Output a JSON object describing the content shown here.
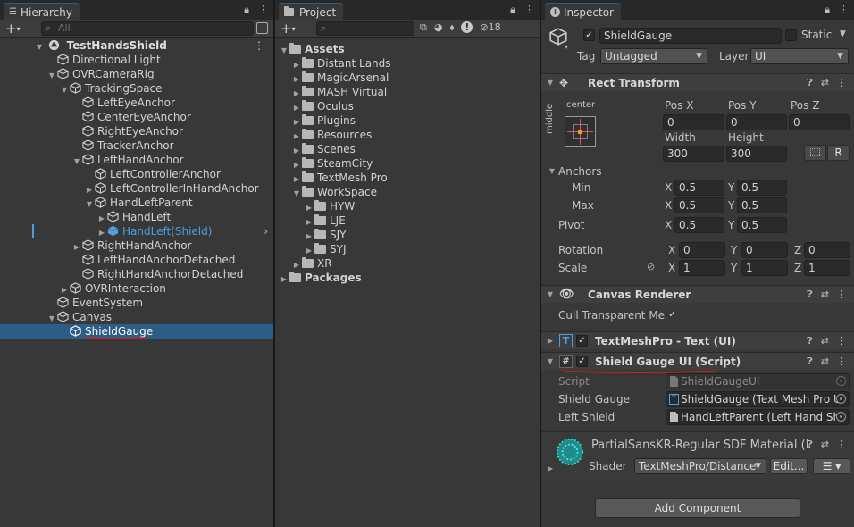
{
  "hierarchy": {
    "tab_label": "Hierarchy",
    "search_placeholder": "All",
    "scene_name": "TestHandsShield",
    "items": [
      {
        "label": "Directional Light"
      },
      {
        "label": "OVRCameraRig"
      },
      {
        "label": "TrackingSpace"
      },
      {
        "label": "LeftEyeAnchor"
      },
      {
        "label": "CenterEyeAnchor"
      },
      {
        "label": "RightEyeAnchor"
      },
      {
        "label": "TrackerAnchor"
      },
      {
        "label": "LeftHandAnchor"
      },
      {
        "label": "LeftControllerAnchor"
      },
      {
        "label": "LeftControllerInHandAnchor"
      },
      {
        "label": "HandLeftParent"
      },
      {
        "label": "HandLeft"
      },
      {
        "label": "HandLeft(Shield)"
      },
      {
        "label": "RightHandAnchor"
      },
      {
        "label": "LeftHandAnchorDetached"
      },
      {
        "label": "RightHandAnchorDetached"
      },
      {
        "label": "OVRInteraction"
      },
      {
        "label": "EventSystem"
      },
      {
        "label": "Canvas"
      },
      {
        "label": "ShieldGauge"
      }
    ]
  },
  "project": {
    "tab_label": "Project",
    "hidden_count": "18",
    "items": [
      {
        "label": "Assets"
      },
      {
        "label": "Distant Lands"
      },
      {
        "label": "MagicArsenal"
      },
      {
        "label": "MASH Virtual"
      },
      {
        "label": "Oculus"
      },
      {
        "label": "Plugins"
      },
      {
        "label": "Resources"
      },
      {
        "label": "Scenes"
      },
      {
        "label": "SteamCity"
      },
      {
        "label": "TextMesh Pro"
      },
      {
        "label": "WorkSpace"
      },
      {
        "label": "HYW"
      },
      {
        "label": "LJE"
      },
      {
        "label": "SJY"
      },
      {
        "label": "SYJ"
      },
      {
        "label": "XR"
      },
      {
        "label": "Packages"
      }
    ]
  },
  "inspector": {
    "tab_label": "Inspector",
    "object_name": "ShieldGauge",
    "static_label": "Static",
    "tag_label": "Tag",
    "tag_value": "Untagged",
    "layer_label": "Layer",
    "layer_value": "UI",
    "rect_transform": {
      "title": "Rect Transform",
      "anchor_preset_h": "center",
      "anchor_preset_v": "middle",
      "pos_x_label": "Pos X",
      "pos_x": "0",
      "pos_y_label": "Pos Y",
      "pos_y": "0",
      "pos_z_label": "Pos Z",
      "pos_z": "0",
      "width_label": "Width",
      "width": "300",
      "height_label": "Height",
      "height": "300",
      "r_button": "R",
      "anchors_label": "Anchors",
      "min_label": "Min",
      "min_x": "0.5",
      "min_y": "0.5",
      "max_label": "Max",
      "max_x": "0.5",
      "max_y": "0.5",
      "pivot_label": "Pivot",
      "pivot_x": "0.5",
      "pivot_y": "0.5",
      "rotation_label": "Rotation",
      "rot_x": "0",
      "rot_y": "0",
      "rot_z": "0",
      "scale_label": "Scale",
      "scale_x": "1",
      "scale_y": "1",
      "scale_z": "1",
      "x": "X",
      "y": "Y",
      "z": "Z"
    },
    "canvas_renderer": {
      "title": "Canvas Renderer",
      "cull_label": "Cull Transparent Mes"
    },
    "textmeshpro": {
      "title": "TextMeshPro - Text (UI)"
    },
    "shield_script": {
      "title": "Shield Gauge UI (Script)",
      "script_label": "Script",
      "script_value": "ShieldGaugeUI",
      "gauge_label": "Shield Gauge",
      "gauge_value": "ShieldGauge (Text Mesh Pro U",
      "left_label": "Left Shield",
      "left_value": "HandLeftParent (Left Hand Sh"
    },
    "material": {
      "name": "PartialSansKR-Regular SDF Material (M",
      "shader_label": "Shader",
      "shader_value": "TextMeshPro/Distance",
      "edit_button": "Edit..."
    },
    "add_component": "Add Component"
  },
  "colors": {
    "selection": "#2c5d87",
    "accent_blue": "#4a9fe3",
    "annotation_red": "#d21f1f"
  }
}
